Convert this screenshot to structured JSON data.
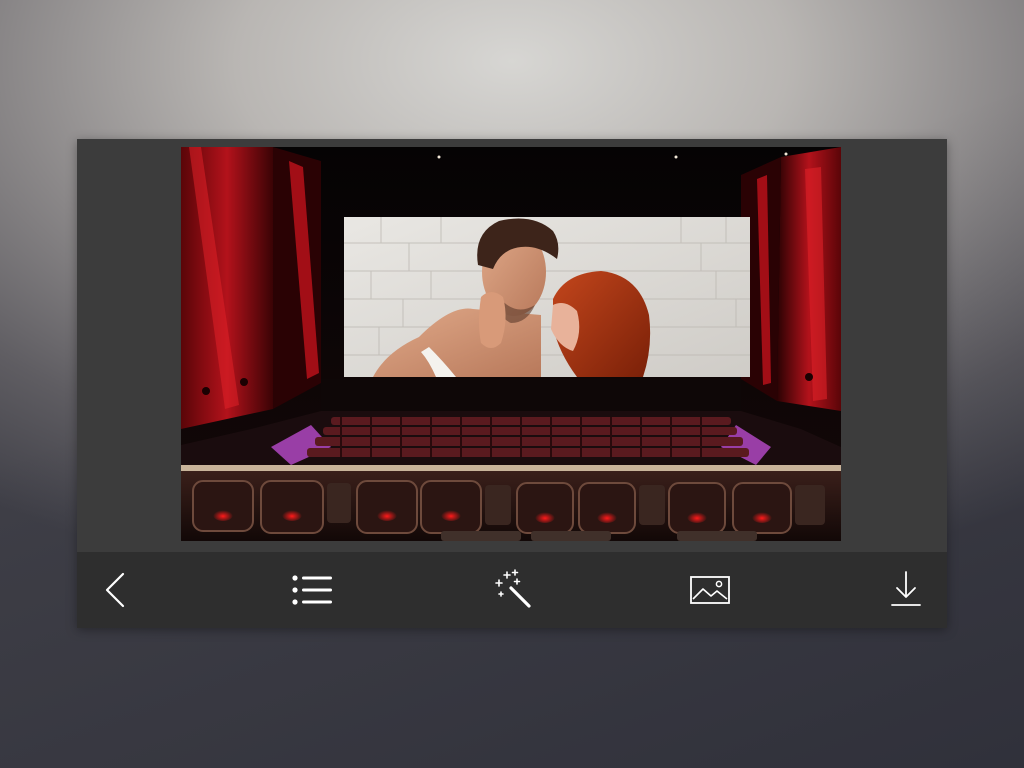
{
  "colors": {
    "frame_bg": "#3c3c3c",
    "toolbar_bg": "#2e2e2e",
    "icon_color": "#ffffff",
    "theater_red": "#c0121b",
    "seat_glow": "#c44fd9"
  },
  "editor": {
    "image": {
      "scene": "cinema-theater-frame",
      "inset": "couple-photo"
    }
  },
  "toolbar": {
    "buttons": [
      {
        "name": "back-button",
        "icon": "chevron-left-icon"
      },
      {
        "name": "frames-list-button",
        "icon": "list-icon"
      },
      {
        "name": "effects-button",
        "icon": "magic-wand-icon"
      },
      {
        "name": "gallery-button",
        "icon": "image-icon"
      },
      {
        "name": "save-button",
        "icon": "download-icon"
      }
    ]
  }
}
